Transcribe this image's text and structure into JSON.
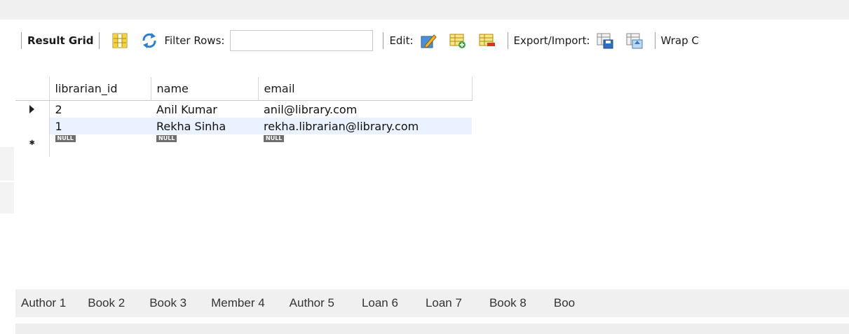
{
  "toolbar": {
    "result_grid_label": "Result Grid",
    "filter_rows_label": "Filter Rows:",
    "filter_value": "",
    "edit_label": "Edit:",
    "export_import_label": "Export/Import:",
    "wrap_label": "Wrap C"
  },
  "grid": {
    "columns": [
      "librarian_id",
      "name",
      "email"
    ],
    "rows": [
      {
        "librarian_id": "2",
        "name": "Anil Kumar",
        "email": "anil@library.com"
      },
      {
        "librarian_id": "1",
        "name": "Rekha Sinha",
        "email": "rekha.librarian@library.com"
      }
    ],
    "null_text": "NULL"
  },
  "tabs": [
    "Author 1",
    "Book 2",
    "Book 3",
    "Member 4",
    "Author 5",
    "Loan 6",
    "Loan 7",
    "Book 8",
    "Boo"
  ],
  "colors": {
    "selected_row_bg": "#eaf2ff",
    "null_badge_bg": "#6f6f6f"
  }
}
